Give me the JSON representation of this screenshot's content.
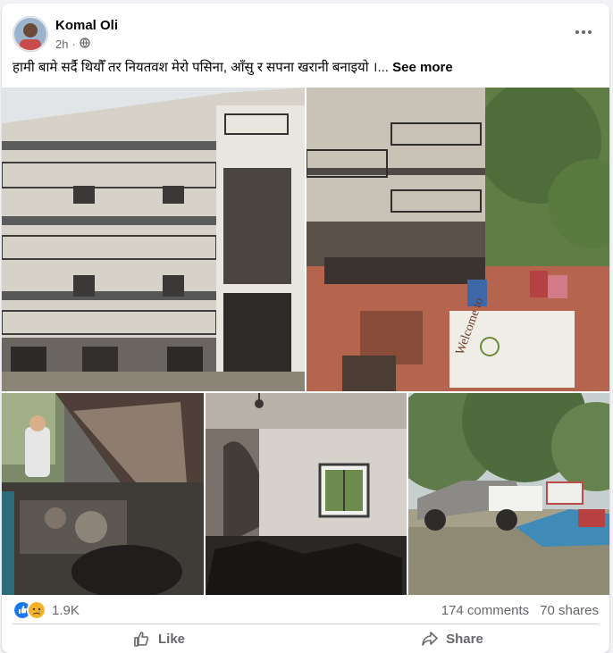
{
  "post": {
    "author": "Komal Oli",
    "time": "2h",
    "privacy_icon": "globe-icon",
    "text": "हामी बामे सर्दै थियौँ तर नियतवश मेरो पसिना, आँसु र सपना खरानी बनाइयो ।...",
    "see_more": "See more",
    "banner_text": "Welcome to"
  },
  "stats": {
    "reactions": "1.9K",
    "reaction_icons": [
      "like-icon",
      "sad-icon"
    ],
    "comments": "174 comments",
    "shares": "70 shares"
  },
  "actions": {
    "like": "Like",
    "share": "Share"
  },
  "colors": {
    "text": "#050505",
    "secondary": "#65676b",
    "like_blue": "#1877f2",
    "sad_yellow": "#f7b125",
    "divider": "#ced0d4"
  }
}
